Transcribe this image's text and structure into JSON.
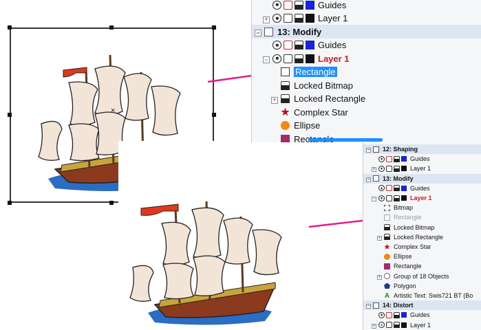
{
  "top_panel": {
    "scrollbar_color": "#1e90ff",
    "rows": [
      {
        "type": "layer",
        "label": "Guides",
        "swatch": "#1523d9",
        "printer": "red"
      },
      {
        "type": "layer",
        "label": "Layer 1",
        "swatch": "#111111",
        "expander": "⊞"
      },
      {
        "type": "page",
        "label": "13: Modify",
        "expander": "⊟"
      },
      {
        "type": "layer",
        "label": "Guides",
        "swatch": "#1523d9",
        "printer": "red"
      },
      {
        "type": "layer",
        "label": "Layer 1",
        "swatch": "#111111",
        "expander": "⊟",
        "active": true
      },
      {
        "type": "object",
        "label": "Rectangle",
        "icon": "rect-outline",
        "selected": true
      },
      {
        "type": "object",
        "label": "Locked Bitmap",
        "icon": "lock"
      },
      {
        "type": "object",
        "label": "Locked Rectangle",
        "icon": "lock",
        "expander": "⊞"
      },
      {
        "type": "object",
        "label": "Complex Star",
        "icon": "star"
      },
      {
        "type": "object",
        "label": "Ellipse",
        "icon": "ellipse"
      },
      {
        "type": "object",
        "label": "Rectangle",
        "icon": "rect-fill"
      }
    ]
  },
  "bottom_panel": {
    "rows": [
      {
        "type": "page",
        "label": "12: Shaping",
        "expander": "⊟"
      },
      {
        "type": "layer",
        "label": "Guides",
        "swatch": "#1523d9",
        "printer": "red"
      },
      {
        "type": "layer",
        "label": "Layer 1",
        "swatch": "#111111",
        "expander": "⊞"
      },
      {
        "type": "page",
        "label": "13: Modify",
        "expander": "⊟"
      },
      {
        "type": "layer",
        "label": "Guides",
        "swatch": "#1523d9",
        "printer": "red"
      },
      {
        "type": "layer",
        "label": "Layer 1",
        "swatch": "#111111",
        "expander": "⊟",
        "active": true
      },
      {
        "type": "object",
        "label": "Bitmap",
        "icon": "bitmap"
      },
      {
        "type": "object",
        "label": "Rectangle",
        "icon": "ghost-rect",
        "ghost": true
      },
      {
        "type": "object",
        "label": "Locked Bitmap",
        "icon": "lock"
      },
      {
        "type": "object",
        "label": "Locked Rectangle",
        "icon": "lock",
        "expander": "⊞"
      },
      {
        "type": "object",
        "label": "Complex Star",
        "icon": "star"
      },
      {
        "type": "object",
        "label": "Ellipse",
        "icon": "ellipse"
      },
      {
        "type": "object",
        "label": "Rectangle",
        "icon": "rect-fill"
      },
      {
        "type": "object",
        "label": "Group of 18 Objects",
        "icon": "group",
        "expander": "⊞"
      },
      {
        "type": "object",
        "label": "Polygon",
        "icon": "polygon"
      },
      {
        "type": "object",
        "label": "Artistic Text: Swis721 BT (Bo",
        "icon": "text"
      },
      {
        "type": "page",
        "label": "14: Distort",
        "expander": "⊟"
      },
      {
        "type": "layer",
        "label": "Guides",
        "swatch": "#1523d9",
        "printer": "red"
      },
      {
        "type": "layer",
        "label": "Layer 1",
        "swatch": "#111111",
        "expander": "⊞"
      }
    ]
  },
  "icons": {
    "text_glyph": "A",
    "eye": "eye-icon",
    "printer": "printer-icon",
    "lock": "lock-icon"
  },
  "colors": {
    "arrow": "#e8178a",
    "selection": "#1e90ff",
    "active_layer": "#e01818",
    "page_row": "#dce6f2"
  }
}
